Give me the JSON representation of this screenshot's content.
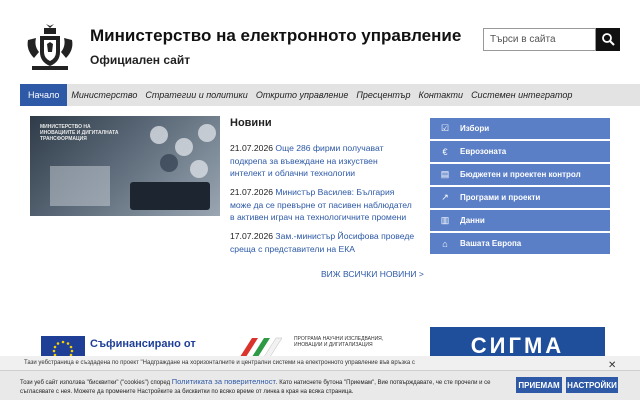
{
  "header": {
    "title": "Министерство на електронното управление",
    "subtitle": "Официален сайт",
    "search_placeholder": "Търси в сайта",
    "logo_icon": "coat-of-arms-icon",
    "search_icon": "search-icon"
  },
  "nav": {
    "items": [
      {
        "label": "Начало"
      },
      {
        "label": "Министерство"
      },
      {
        "label": "Стратегии и политики"
      },
      {
        "label": "Открито управление"
      },
      {
        "label": "Пресцентър"
      },
      {
        "label": "Контакти"
      },
      {
        "label": "Системен интегратор"
      }
    ]
  },
  "hero": {
    "caption": "МИНИСТЕРСТВО НА ИНОВАЦИИТЕ И ДИГИТАЛНАТА ТРАНСФОРМАЦИЯ"
  },
  "news": {
    "title": "Новини",
    "items": [
      {
        "date": "21.07.2026",
        "text": "Още 286 фирми получават подкрепа за въвеждане на изкуствен интелект и облачни технологии"
      },
      {
        "date": "21.07.2026",
        "text": "Министър Василев: България може да се превърне от пасивен наблюдател в активен играч на технологичните промени"
      },
      {
        "date": "17.07.2026",
        "text": "Зам.-министър Йосифова проведе среща с представители на ЕКА"
      }
    ],
    "all_label": "ВИЖ ВСИЧКИ НОВИНИ >"
  },
  "side_links": [
    {
      "label": "Избори",
      "icon": "checkbox-icon"
    },
    {
      "label": "Еврозоната",
      "icon": "euro-icon"
    },
    {
      "label": "Бюджетен и проектен контрол",
      "icon": "folder-icon"
    },
    {
      "label": "Програми и проекти",
      "icon": "chart-icon"
    },
    {
      "label": "Данни",
      "icon": "book-icon"
    },
    {
      "label": "Вашата Европа",
      "icon": "institution-icon"
    }
  ],
  "partners": {
    "eu_text": "Съфинансирано от",
    "program_text": "ПРОГРАМА НАУЧНИ ИЗСЛЕДВАНИЯ, ИНОВАЦИИ И ДИГИТАЛИЗАЦИЯ",
    "sigma": "СИГМА"
  },
  "notice": {
    "text": "Тази уебстраница е създадена по проект \"Надграждане на хоризонталните и централни системи на електронното управление във връзка с"
  },
  "cookie": {
    "text_before": "Този уеб сайт използва \"бисквитки\" (\"cookies\") според ",
    "link": "Политиката за поверителност",
    "text_after": ". Като натиснете бутона \"Приемам\", Вие потвърждавате, че сте прочели и се съгласявате с нея. Можете да промените Настройките за бисквитки по всяко време от линка в края на всяка страница.",
    "accept_label": "ПРИЕМАМ",
    "settings_label": "НАСТРОЙКИ",
    "close_icon": "close-icon"
  },
  "colors": {
    "accent": "#2d59a6",
    "side_button": "#5b7fc6",
    "nav_bg": "#e3e3e3"
  }
}
